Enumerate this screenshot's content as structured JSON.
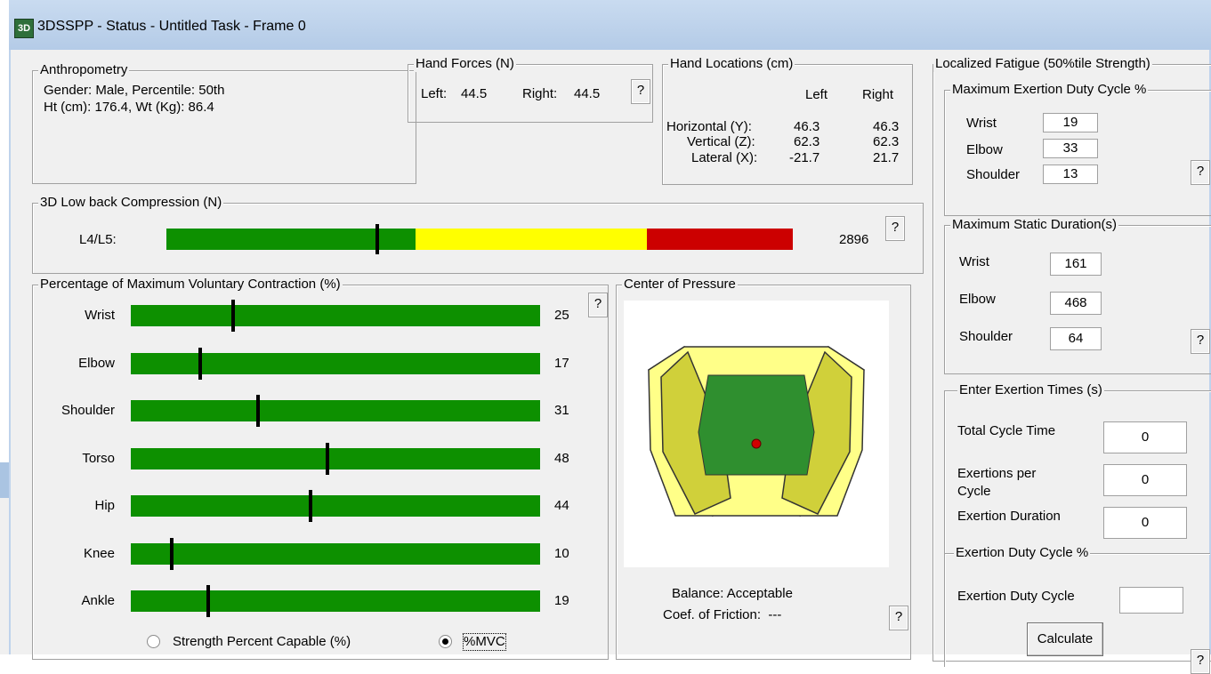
{
  "window": {
    "title": "3DSSPP - Status - Untitled Task - Frame 0",
    "icon_text": "3D"
  },
  "anthropometry": {
    "title": "Anthropometry",
    "line1": "Gender: Male, Percentile: 50th",
    "line2": "Ht (cm): 176.4, Wt (Kg): 86.4"
  },
  "hand_forces": {
    "title": "Hand Forces (N)",
    "left_label": "Left:",
    "left_value": "44.5",
    "right_label": "Right:",
    "right_value": "44.5",
    "help": "?"
  },
  "hand_locations": {
    "title": "Hand Locations (cm)",
    "col_left": "Left",
    "col_right": "Right",
    "rows": [
      {
        "label": "Horizontal (Y):",
        "left": "46.3",
        "right": "46.3"
      },
      {
        "label": "Vertical (Z):",
        "left": "62.3",
        "right": "62.3"
      },
      {
        "label": "Lateral (X):",
        "left": "-21.7",
        "right": "21.7"
      }
    ]
  },
  "compression": {
    "title": "3D Low back Compression (N)",
    "label": "L4/L5:",
    "value": "2896",
    "help": "?",
    "marker_fraction": 0.337,
    "colors": {
      "green": "#0d9000",
      "yellow": "#ffff00",
      "red": "#cc0000"
    }
  },
  "mvc": {
    "title": "Percentage of Maximum Voluntary Contraction (%)",
    "help": "?",
    "rows": [
      {
        "label": "Wrist",
        "value": "25",
        "pct": 25
      },
      {
        "label": "Elbow",
        "value": "17",
        "pct": 17
      },
      {
        "label": "Shoulder",
        "value": "31",
        "pct": 31
      },
      {
        "label": "Torso",
        "value": "48",
        "pct": 48
      },
      {
        "label": "Hip",
        "value": "44",
        "pct": 44
      },
      {
        "label": "Knee",
        "value": "10",
        "pct": 10
      },
      {
        "label": "Ankle",
        "value": "19",
        "pct": 19
      }
    ],
    "radio_strength": "Strength Percent Capable (%)",
    "radio_mvc": "%MVC",
    "selected": "mvc"
  },
  "center_of_pressure": {
    "title": "Center of Pressure",
    "balance": "Balance: Acceptable",
    "friction": "Coef. of Friction:  ---",
    "help": "?"
  },
  "fatigue": {
    "title": "Localized Fatigue (50%tile Strength)",
    "duty_title": "Maximum Exertion Duty Cycle %",
    "duty_rows": [
      {
        "label": "Wrist",
        "value": "19"
      },
      {
        "label": "Elbow",
        "value": "33"
      },
      {
        "label": "Shoulder",
        "value": "13"
      }
    ],
    "static_title": "Maximum Static Duration(s)",
    "static_rows": [
      {
        "label": "Wrist",
        "value": "161"
      },
      {
        "label": "Elbow",
        "value": "468"
      },
      {
        "label": "Shoulder",
        "value": "64"
      }
    ],
    "help": "?"
  },
  "exertion": {
    "title": "Enter Exertion Times (s)",
    "total_cycle_label": "Total Cycle Time",
    "total_cycle_value": "0",
    "exertions_label_1": "Exertions per",
    "exertions_label_2": "Cycle",
    "exertions_value": "0",
    "duration_label": "Exertion Duration",
    "duration_value": "0",
    "duty_title": "Exertion Duty Cycle %",
    "duty_label": "Exertion Duty Cycle",
    "duty_value": "",
    "calculate": "Calculate",
    "help": "?"
  }
}
